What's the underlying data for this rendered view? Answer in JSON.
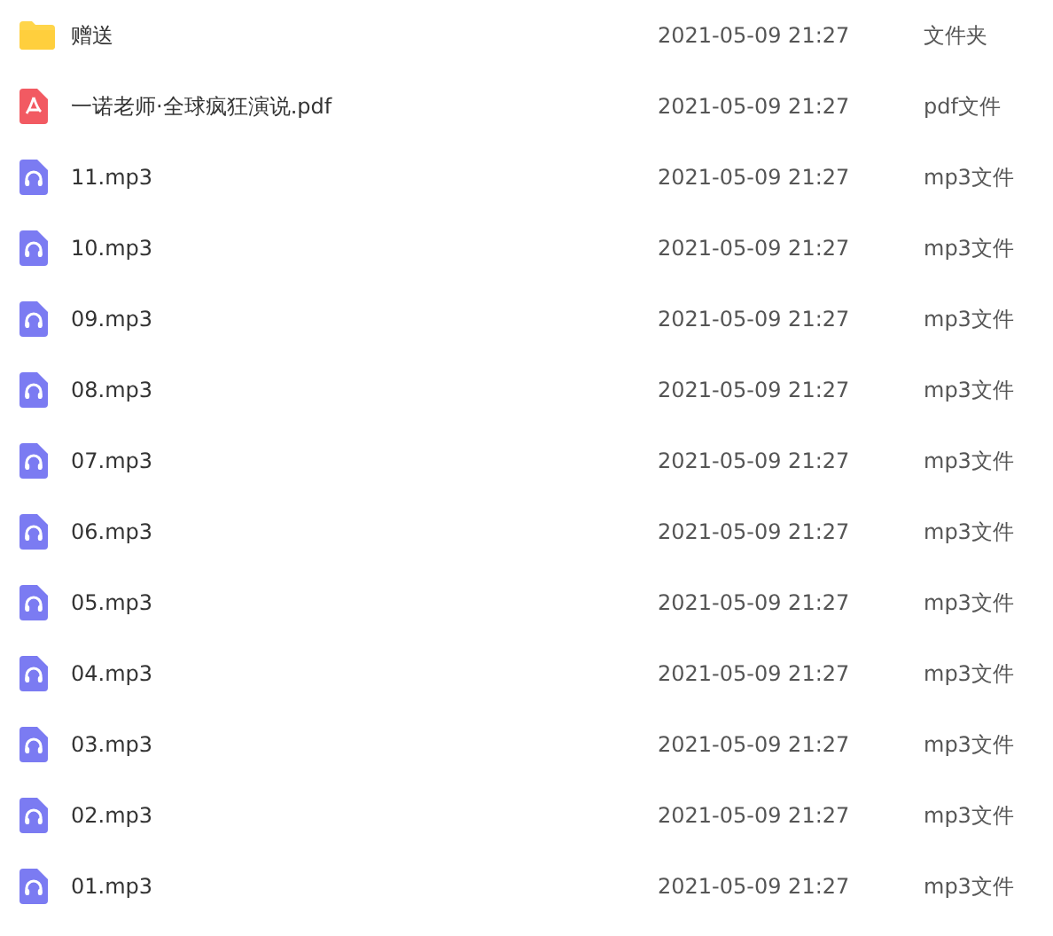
{
  "files": [
    {
      "kind": "folder",
      "name": "赠送",
      "modified": "2021-05-09 21:27",
      "type": "文件夹"
    },
    {
      "kind": "pdf",
      "name": "一诺老师·全球疯狂演说.pdf",
      "modified": "2021-05-09 21:27",
      "type": "pdf文件"
    },
    {
      "kind": "audio",
      "name": "11.mp3",
      "modified": "2021-05-09 21:27",
      "type": "mp3文件"
    },
    {
      "kind": "audio",
      "name": "10.mp3",
      "modified": "2021-05-09 21:27",
      "type": "mp3文件"
    },
    {
      "kind": "audio",
      "name": "09.mp3",
      "modified": "2021-05-09 21:27",
      "type": "mp3文件"
    },
    {
      "kind": "audio",
      "name": "08.mp3",
      "modified": "2021-05-09 21:27",
      "type": "mp3文件"
    },
    {
      "kind": "audio",
      "name": "07.mp3",
      "modified": "2021-05-09 21:27",
      "type": "mp3文件"
    },
    {
      "kind": "audio",
      "name": "06.mp3",
      "modified": "2021-05-09 21:27",
      "type": "mp3文件"
    },
    {
      "kind": "audio",
      "name": "05.mp3",
      "modified": "2021-05-09 21:27",
      "type": "mp3文件"
    },
    {
      "kind": "audio",
      "name": "04.mp3",
      "modified": "2021-05-09 21:27",
      "type": "mp3文件"
    },
    {
      "kind": "audio",
      "name": "03.mp3",
      "modified": "2021-05-09 21:27",
      "type": "mp3文件"
    },
    {
      "kind": "audio",
      "name": "02.mp3",
      "modified": "2021-05-09 21:27",
      "type": "mp3文件"
    },
    {
      "kind": "audio",
      "name": "01.mp3",
      "modified": "2021-05-09 21:27",
      "type": "mp3文件"
    }
  ]
}
